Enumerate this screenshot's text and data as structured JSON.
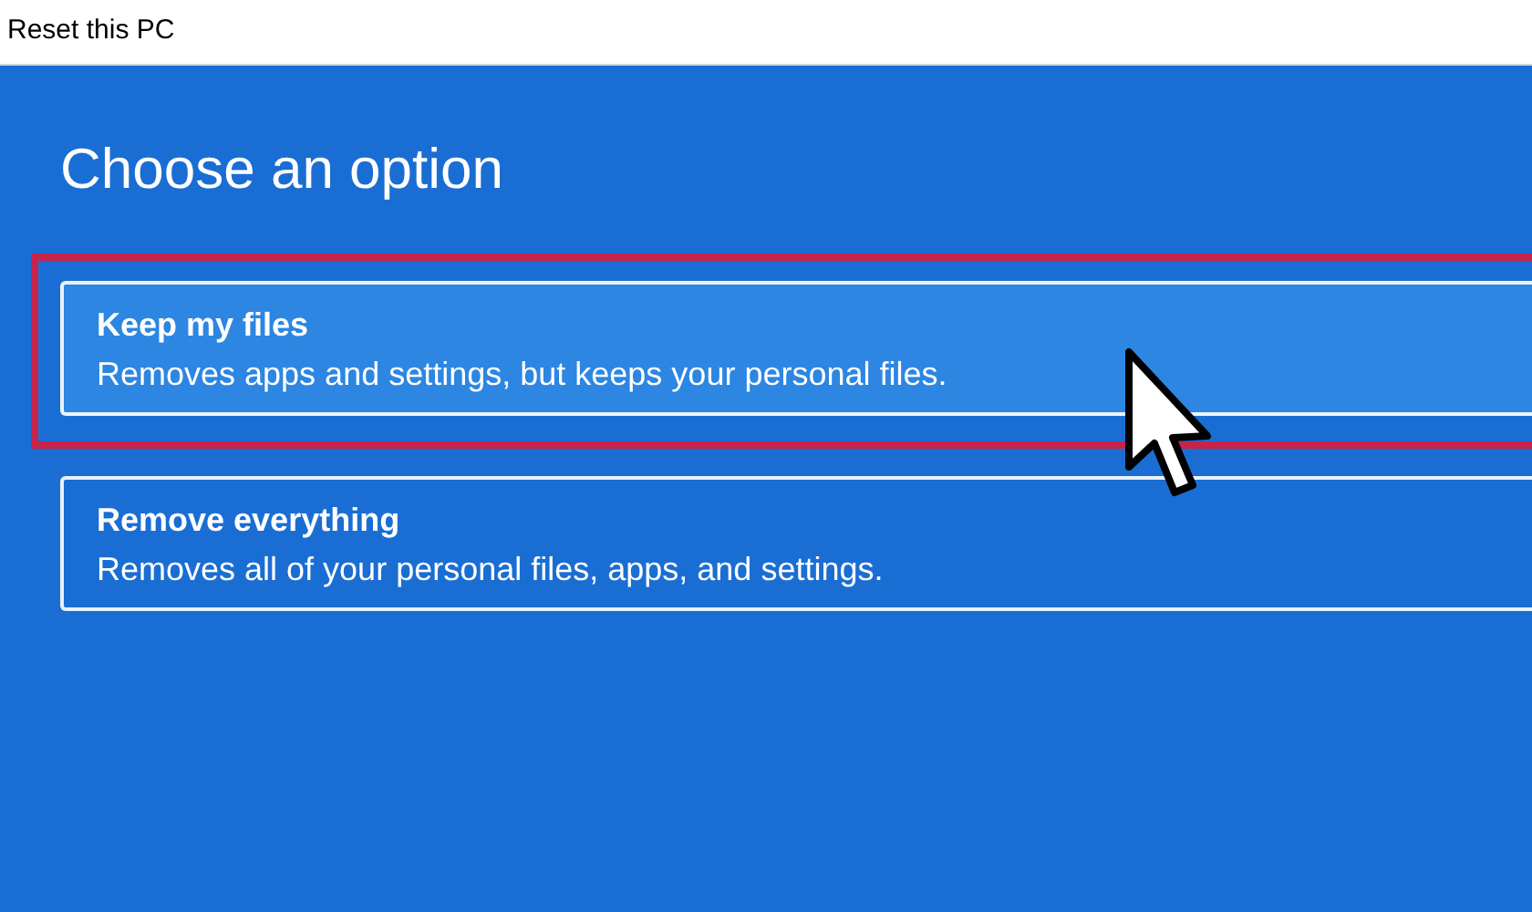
{
  "window": {
    "title": "Reset this PC"
  },
  "heading": "Choose an option",
  "options": [
    {
      "title": "Keep my files",
      "description": "Removes apps and settings, but keeps your personal files.",
      "selected": true,
      "highlighted": true
    },
    {
      "title": "Remove everything",
      "description": "Removes all of your personal files, apps, and settings.",
      "selected": false,
      "highlighted": false
    }
  ]
}
